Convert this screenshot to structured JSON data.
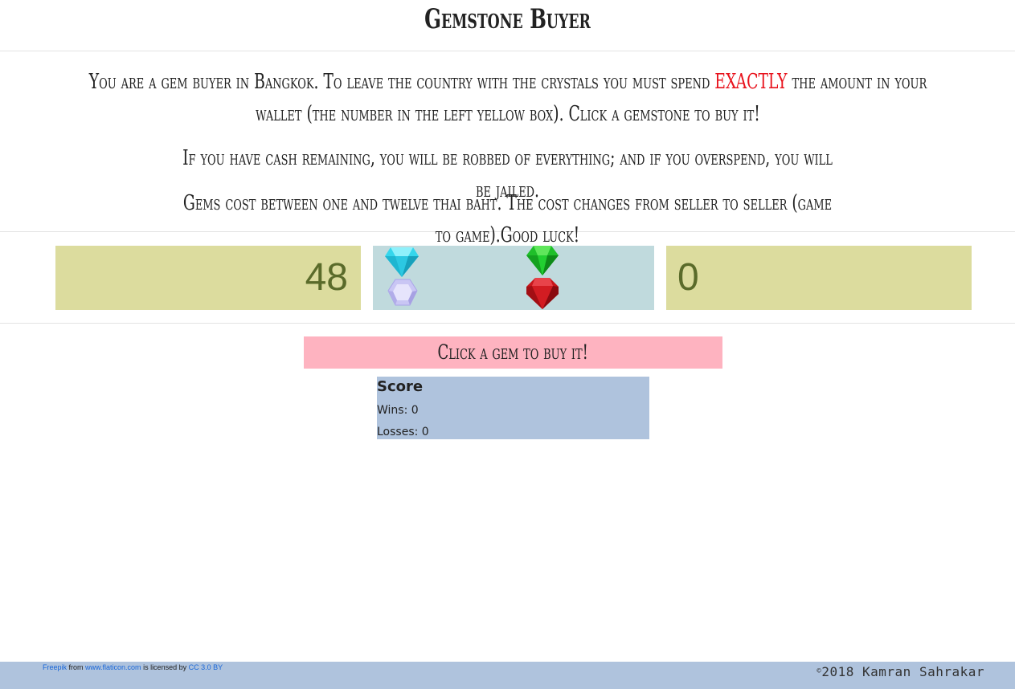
{
  "header": {
    "title": "Gemstone Buyer"
  },
  "intro": {
    "p1_before": "You are a gem buyer in Bangkok. To leave the country with the crystals you must spend ",
    "p1_accent": "EXACTLY",
    "p1_after": " the amount in your wallet (the number in the left yellow box). Click a gemstone to buy it!",
    "p2": "If you have cash remaining, you will be robbed of everything; and if you overspend, you will be jailed.",
    "p3": "Gems cost between one and twelve thai baht. The cost changes from seller to seller (game to game).Good luck!"
  },
  "game": {
    "wallet_value": "48",
    "spent_value": "0",
    "gems": [
      "cyan-diamond",
      "lavender-crystal",
      "green-emerald",
      "red-ruby"
    ]
  },
  "status": {
    "message": "Click a gem to buy it!"
  },
  "score": {
    "title": "Score",
    "wins_label": "Wins: 0",
    "losses_label": "Losses: 0"
  },
  "footer": {
    "credit_author": "Freepik",
    "credit_from": " from ",
    "credit_site": "www.flaticon.com",
    "credit_licensed": " is licensed by ",
    "credit_license": "CC 3.0 BY",
    "copyright_symbol": "©",
    "copyright_text": "2018 Kamran Sahrakar"
  },
  "colors": {
    "wallet_bg": "#dcdc9e",
    "gems_bg": "#c0dadd",
    "status_bg": "#feb3c0",
    "score_bg": "#afc3dd",
    "accent": "#e8121c",
    "number": "#5a6b2a"
  }
}
